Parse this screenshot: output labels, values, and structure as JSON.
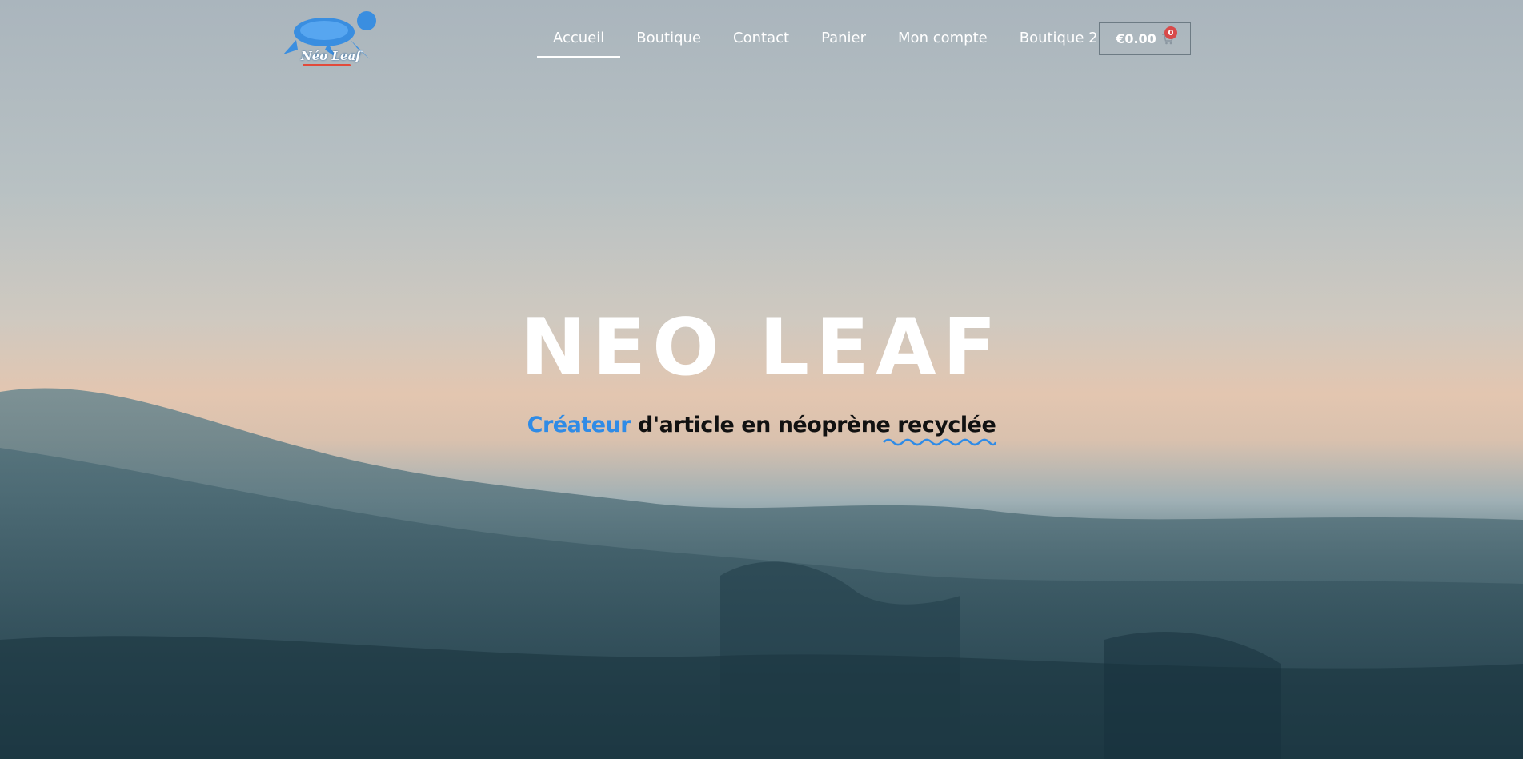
{
  "brand": {
    "logo_text": "Néo Leaf",
    "logo_icon": "turtle-icon",
    "accent_color": "#2f8be6"
  },
  "nav": {
    "items": [
      {
        "label": "Accueil",
        "active": true
      },
      {
        "label": "Boutique",
        "active": false
      },
      {
        "label": "Contact",
        "active": false
      },
      {
        "label": "Panier",
        "active": false
      },
      {
        "label": "Mon compte",
        "active": false
      },
      {
        "label": "Boutique 2",
        "active": false
      }
    ]
  },
  "cart": {
    "amount": "€0.00",
    "count": "0",
    "icon": "cart-icon",
    "badge_color": "#d84a4a"
  },
  "hero": {
    "title": "NEO LEAF",
    "subtitle": {
      "accent": "Créateur",
      "middle": "d'article en néoprène",
      "highlight": "recyclée"
    }
  }
}
